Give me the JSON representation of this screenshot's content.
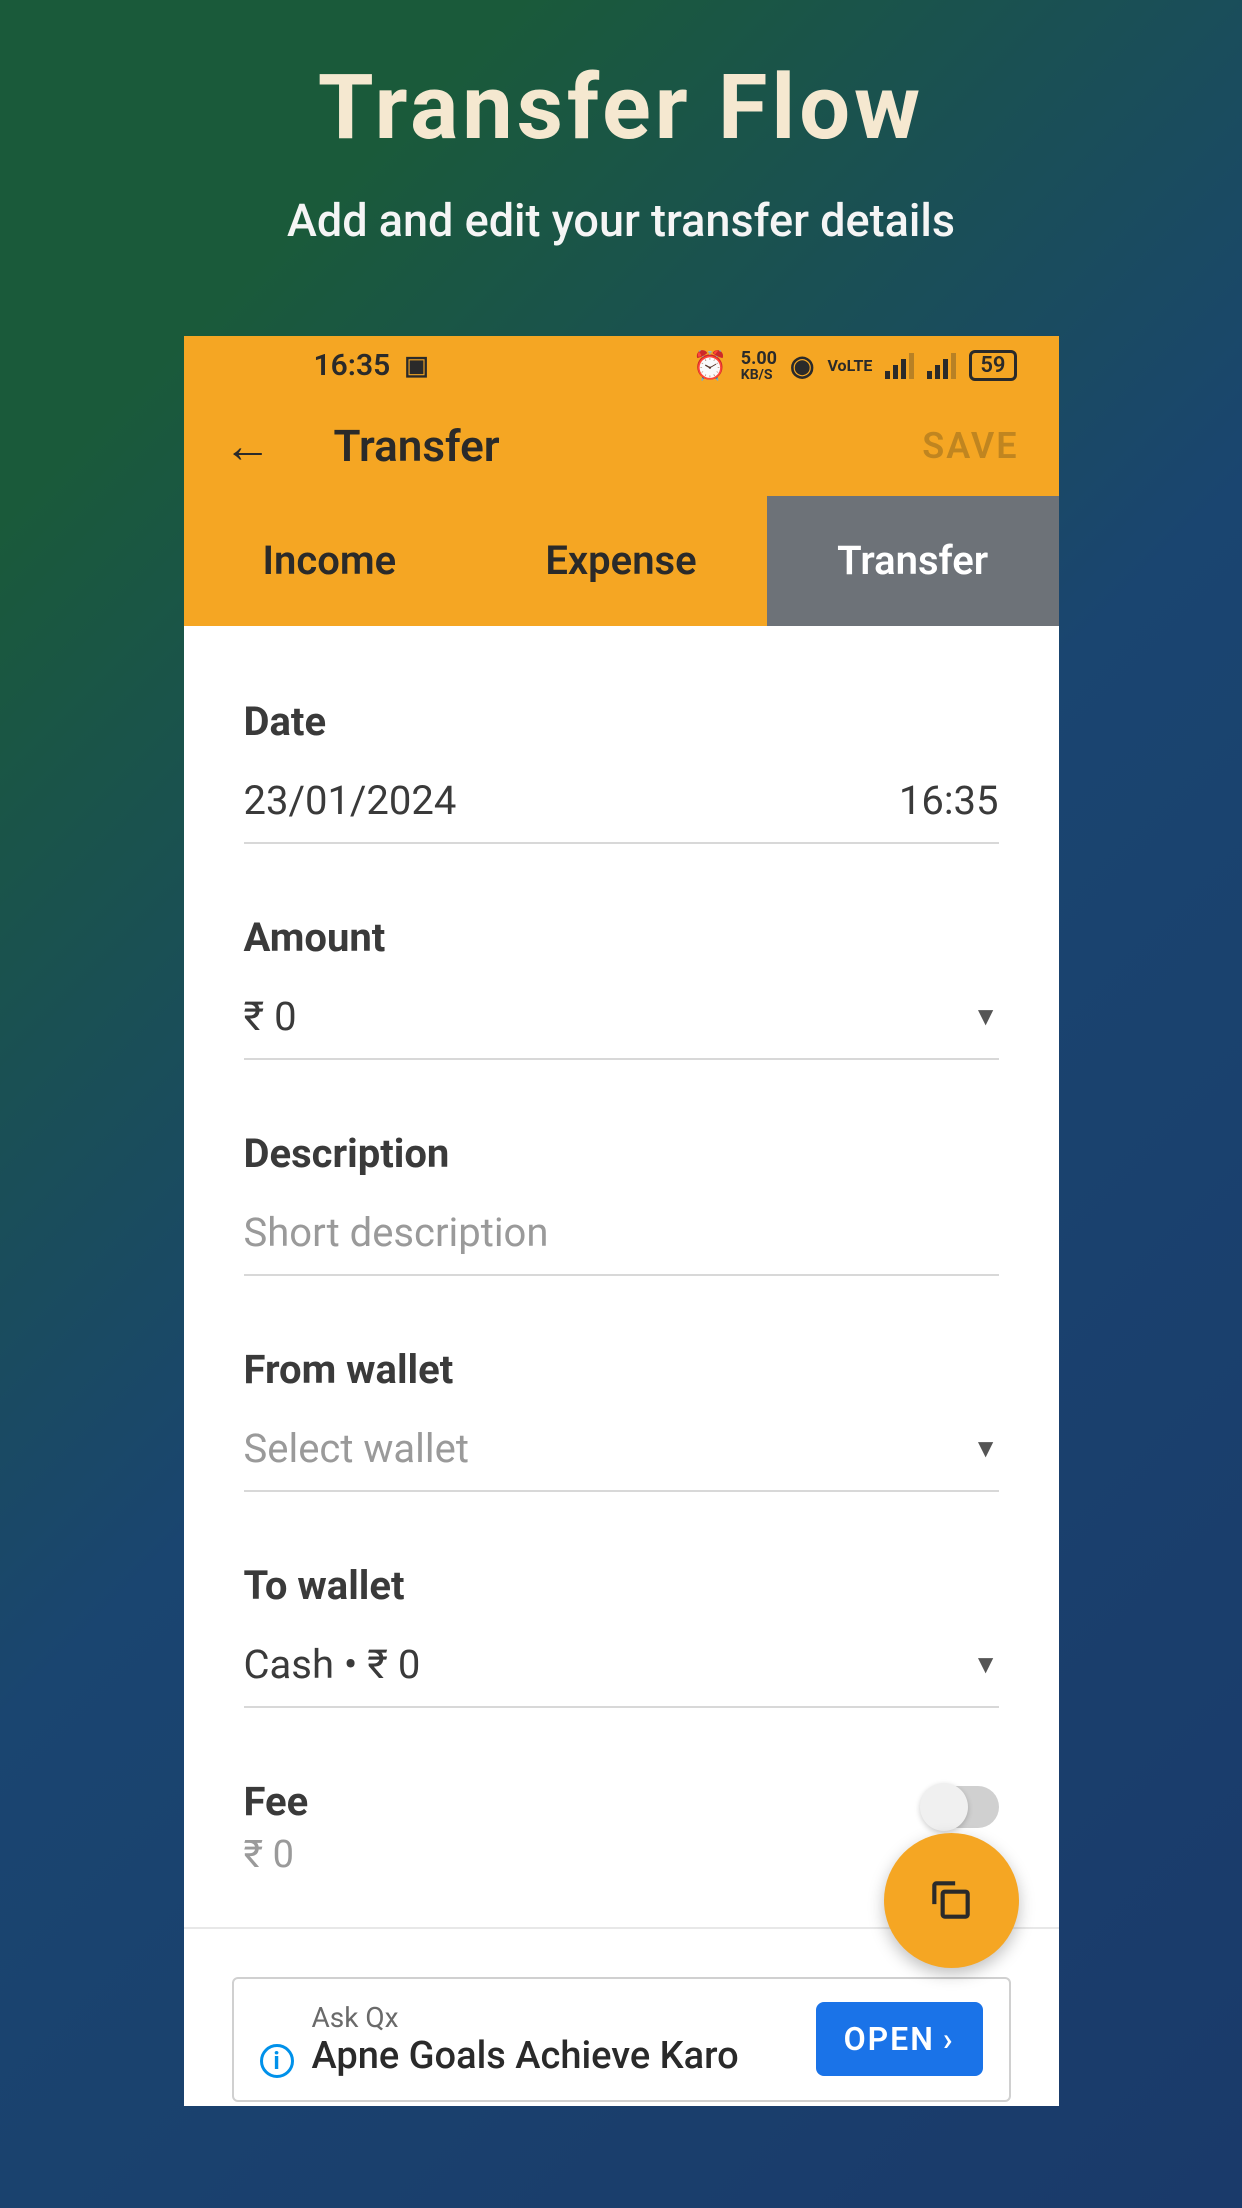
{
  "promo": {
    "title": "Transfer  Flow",
    "subtitle": "Add and edit your transfer details"
  },
  "statusBar": {
    "time": "16:35",
    "kbps": "5.00",
    "kbpsUnit": "KB/S",
    "voiceLabel": "VoLTE",
    "battery": "59"
  },
  "appBar": {
    "title": "Transfer",
    "saveLabel": "SAVE"
  },
  "tabs": {
    "income": "Income",
    "expense": "Expense",
    "transfer": "Transfer"
  },
  "fields": {
    "date": {
      "label": "Date",
      "dateValue": "23/01/2024",
      "timeValue": "16:35"
    },
    "amount": {
      "label": "Amount",
      "value": "₹ 0"
    },
    "description": {
      "label": "Description",
      "placeholder": "Short description"
    },
    "fromWallet": {
      "label": "From wallet",
      "placeholder": "Select wallet"
    },
    "toWallet": {
      "label": "To wallet",
      "value": "Cash • ₹ 0"
    },
    "fee": {
      "label": "Fee",
      "value": "₹ 0"
    }
  },
  "ad": {
    "brand": "Ask Qx",
    "title": "Apne Goals Achieve Karo",
    "cta": "OPEN"
  }
}
